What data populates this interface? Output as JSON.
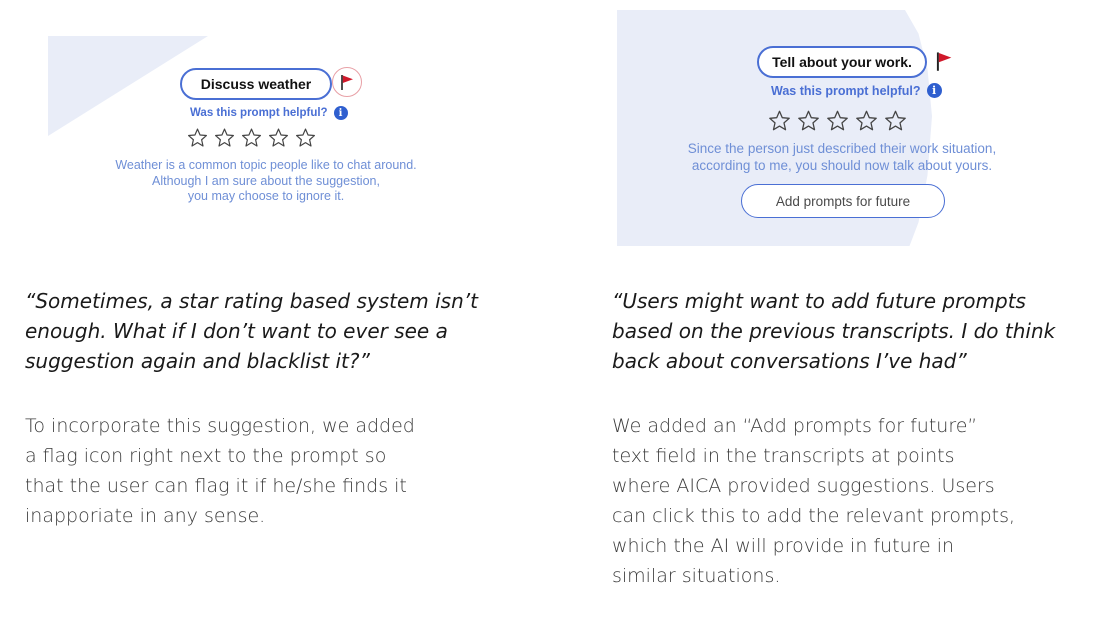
{
  "left_mockup": {
    "prompt_label": "Discuss weather",
    "flag_icon": "red-flag-icon",
    "helpful_question": "Was this prompt helpful?",
    "info_icon": "info-icon",
    "info_glyph": "i",
    "star_count": 5,
    "explanation": [
      "Weather is a common topic people like to chat around.",
      "Although I am sure about the suggestion,",
      "you may choose to ignore it."
    ]
  },
  "right_mockup": {
    "prompt_label": "Tell about your work.",
    "flag_icon": "red-flag-icon",
    "helpful_question": "Was this prompt helpful?",
    "info_icon": "info-icon",
    "info_glyph": "i",
    "star_count": 5,
    "explanation": [
      "Since the person just described their work situation,",
      "according to me, you should now talk about yours."
    ],
    "add_button_label": "Add prompts for future"
  },
  "left_column": {
    "quote": [
      "“Sometimes, a star rating based system isn’t",
      "enough. What if I don’t want to ever see a",
      "suggestion again and blacklist it?”"
    ],
    "body": [
      "To incorporate this suggestion, we added",
      "a flag icon right next to the prompt so",
      "that the user can flag it if he/she finds it",
      "inapporiate in any sense."
    ]
  },
  "right_column": {
    "quote": [
      "“Users might want to add future prompts",
      "based on the previous transcripts. I do think",
      "back about conversations I’ve had”"
    ],
    "body": [
      "We added an “Add prompts for future”",
      "text field in the transcripts at points",
      "where AICA provided suggestions. Users",
      "can click this to add the relevant prompts,",
      "which the AI will provide in future in",
      "similar situations."
    ]
  },
  "colors": {
    "accent_blue": "#4a6fd4",
    "soft_blue_bg": "#e9edf8",
    "flag_red": "#d0192b",
    "explanation_blue": "#6f8fd6"
  }
}
